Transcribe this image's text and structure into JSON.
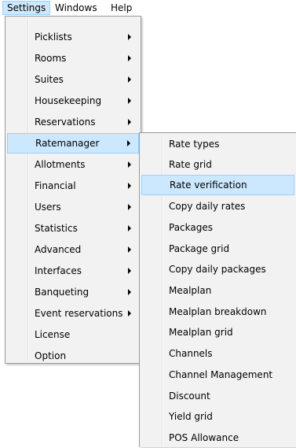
{
  "menubar": {
    "items": [
      {
        "label": "Settings",
        "active": true
      },
      {
        "label": "Windows",
        "active": false
      },
      {
        "label": "Help",
        "active": false
      }
    ]
  },
  "settings_menu": {
    "items": [
      {
        "label": "Picklists",
        "submenu": true
      },
      {
        "label": "Rooms",
        "submenu": true
      },
      {
        "label": "Suites",
        "submenu": true
      },
      {
        "label": "Housekeeping",
        "submenu": true
      },
      {
        "label": "Reservations",
        "submenu": true
      },
      {
        "label": "Ratemanager",
        "submenu": true,
        "highlighted": true
      },
      {
        "label": "Allotments",
        "submenu": true
      },
      {
        "label": "Financial",
        "submenu": true
      },
      {
        "label": "Users",
        "submenu": true
      },
      {
        "label": "Statistics",
        "submenu": true
      },
      {
        "label": "Advanced",
        "submenu": true
      },
      {
        "label": "Interfaces",
        "submenu": true
      },
      {
        "label": "Banqueting",
        "submenu": true
      },
      {
        "label": "Event reservations",
        "submenu": true
      },
      {
        "label": "License",
        "submenu": false
      },
      {
        "label": "Option",
        "submenu": false
      }
    ]
  },
  "ratemanager_menu": {
    "items": [
      {
        "label": "Rate types"
      },
      {
        "label": "Rate grid"
      },
      {
        "label": "Rate verification",
        "highlighted": true
      },
      {
        "label": "Copy daily rates"
      },
      {
        "label": "Packages"
      },
      {
        "label": "Package grid"
      },
      {
        "label": "Copy daily packages"
      },
      {
        "label": "Mealplan"
      },
      {
        "label": "Mealplan breakdown"
      },
      {
        "label": "Mealplan grid"
      },
      {
        "label": "Channels"
      },
      {
        "label": "Channel Management"
      },
      {
        "label": "Discount"
      },
      {
        "label": "Yield grid"
      },
      {
        "label": "POS Allowance"
      }
    ]
  },
  "colors": {
    "menu_background": "#f2f2f2",
    "highlight_fill": "#cce8ff",
    "highlight_border": "#99d1ff"
  }
}
